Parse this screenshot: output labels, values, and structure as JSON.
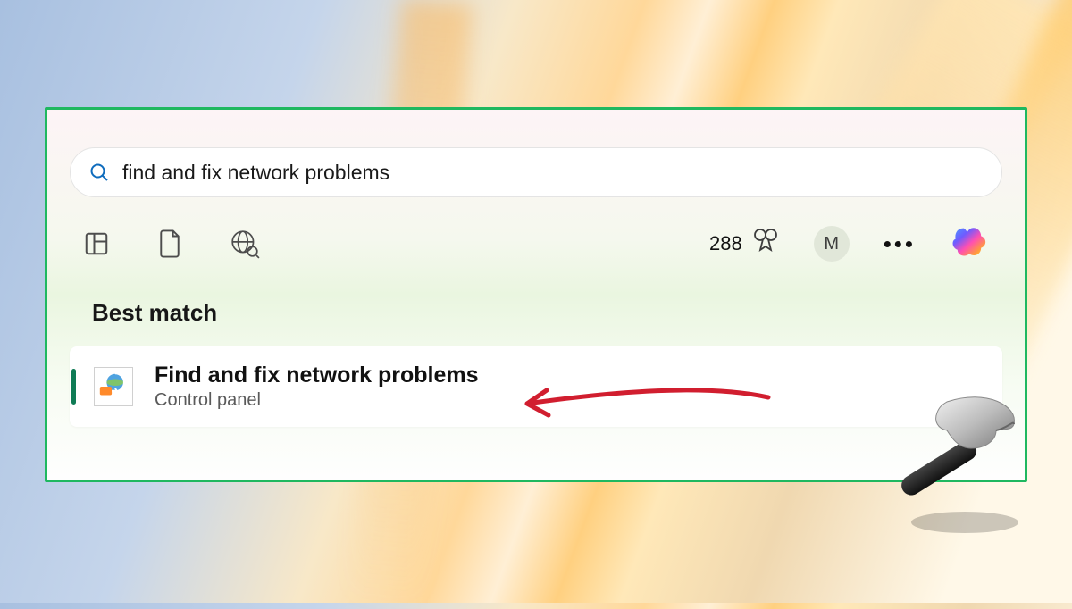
{
  "search": {
    "query": "find and fix network problems"
  },
  "toolbar": {
    "rewards_points": "288",
    "avatar_initial": "M"
  },
  "results": {
    "section_label": "Best match",
    "best_match": {
      "title": "Find and fix network problems",
      "subtitle": "Control panel"
    }
  },
  "icons": {
    "search": "search-icon",
    "apps": "apps-icon",
    "documents": "documents-icon",
    "web": "web-icon",
    "rewards": "rewards-badge-icon",
    "more": "more-icon",
    "copilot": "copilot-icon"
  },
  "colors": {
    "panel_border": "#1fb860",
    "accent": "#0f6cbd",
    "annotation": "#d11e2f"
  }
}
